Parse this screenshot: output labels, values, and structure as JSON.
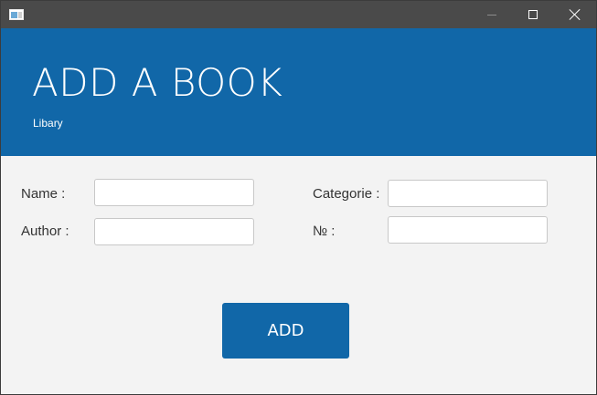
{
  "window": {
    "icon": "app-window-icon",
    "controls": {
      "minimize": "minimize-icon",
      "maximize": "maximize-icon",
      "close": "close-icon"
    }
  },
  "header": {
    "title": "ADD A BOOK",
    "subtitle": "Libary",
    "background": "#1167a8"
  },
  "form": {
    "name_label": "Name :",
    "author_label": "Author :",
    "category_label": "Categorie :",
    "number_label": "№ :",
    "name_value": "",
    "author_value": "",
    "category_value": "",
    "number_value": ""
  },
  "actions": {
    "add_label": "ADD",
    "accent": "#1167a8"
  }
}
